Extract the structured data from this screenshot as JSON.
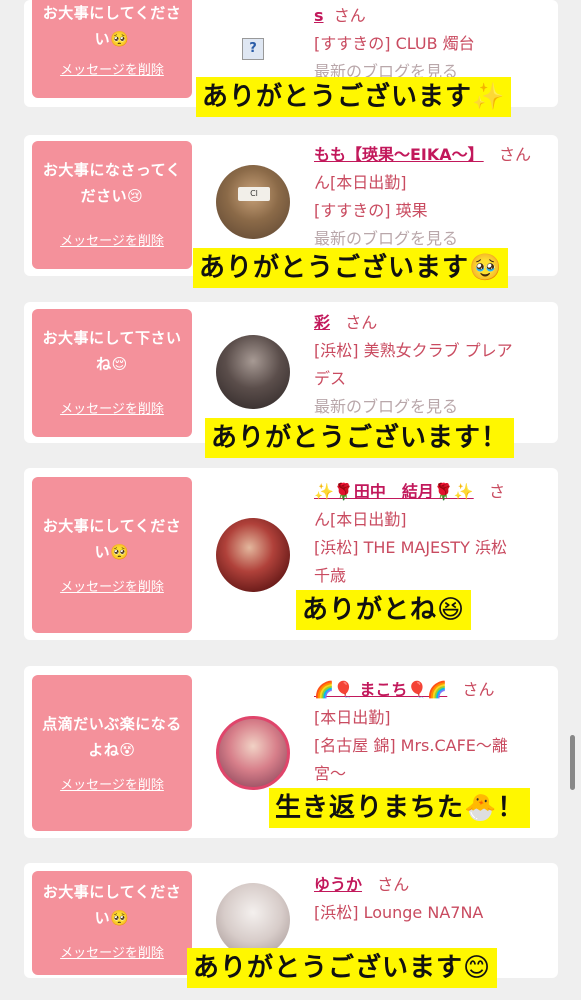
{
  "cards": [
    {
      "message": "お大事にしてください🥺",
      "delete_label": "メッセージを削除",
      "name": "s",
      "san": "さん",
      "lines": [
        "[すすきの] CLUB 燭台"
      ],
      "ghost": "最新のブログを見る",
      "caption": "ありがとうございます✨"
    },
    {
      "message": "お大事になさってください😢",
      "delete_label": "メッセージを削除",
      "name": "もも【瑛果〜EIKA〜】",
      "san": "さん",
      "lines": [
        "ん[本日出勤]",
        "[すすきの] 瑛果"
      ],
      "ghost": "最新のブログを見る",
      "caption": "ありがとうございます🥹"
    },
    {
      "message": "お大事にして下さいね😌",
      "delete_label": "メッセージを削除",
      "name": "彩",
      "san": "さん",
      "lines": [
        "[浜松] 美熟女クラブ プレア",
        "デス"
      ],
      "ghost": "最新のブログを見る",
      "caption": "ありがとうございます！"
    },
    {
      "message": "お大事にしてください🥺",
      "delete_label": "メッセージを削除",
      "name": "✨🌹田中　結月🌹✨",
      "san": "さ",
      "lines": [
        "ん[本日出勤]",
        "[浜松] THE MAJESTY 浜松",
        "千歳"
      ],
      "ghost": "",
      "caption": "ありがとね😆"
    },
    {
      "message": "点滴だいぶ楽になるよね😵",
      "delete_label": "メッセージを削除",
      "name": "🌈🎈 まこち🎈🌈",
      "san": "さん",
      "lines": [
        "[本日出勤]",
        "[名古屋 錦] Mrs.CAFE〜離",
        "宮〜"
      ],
      "ghost": "",
      "caption": "生き返りまちた🐣！"
    },
    {
      "message": "お大事にしてください🥺",
      "delete_label": "メッセージを削除",
      "name": "ゆうか",
      "san": "さん",
      "lines": [
        "[浜松] Lounge NA7NA"
      ],
      "ghost": "",
      "caption": "ありがとうございます😊"
    }
  ],
  "colors": {
    "background": "#efefef",
    "message_bubble": "#f4919b",
    "name_link": "#c2185b",
    "info_text": "#c94b60",
    "caption_highlight": "#fff700"
  },
  "broken_image_glyph": "?"
}
